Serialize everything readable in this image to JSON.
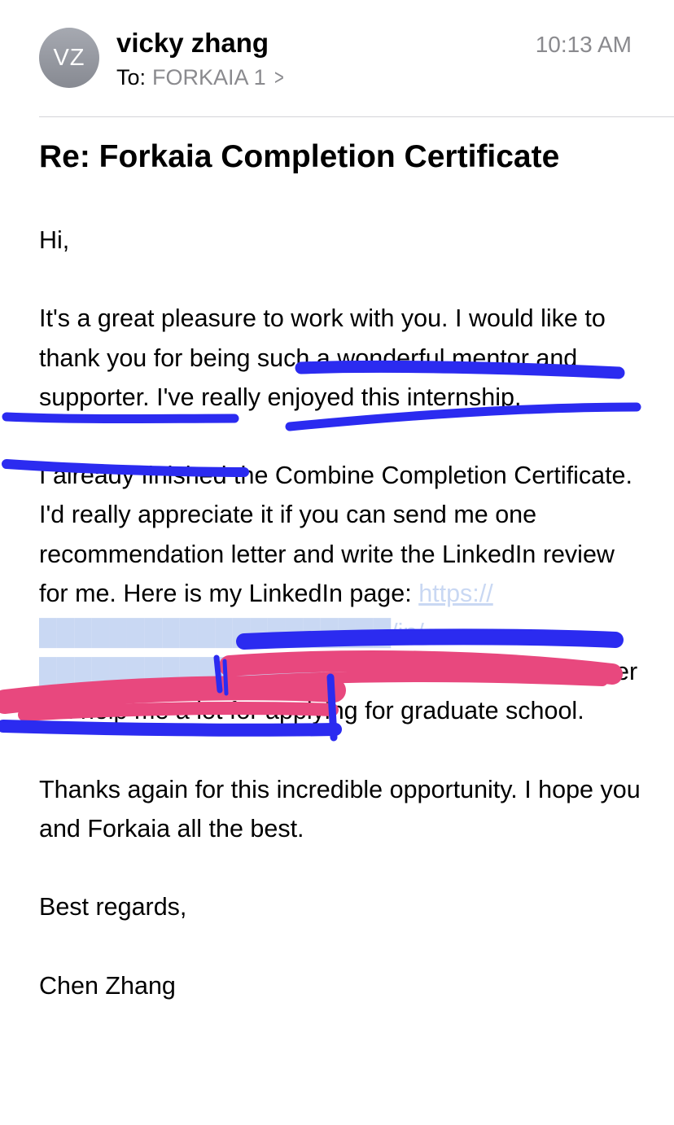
{
  "header": {
    "avatar_initials": "VZ",
    "sender_name": "vicky zhang",
    "time": "10:13 AM",
    "to_label": "To:",
    "recipient": "FORKAIA 1",
    "chevron": "chevron-right-icon"
  },
  "email": {
    "subject": "Re: Forkaia Completion Certificate",
    "greeting": "Hi,",
    "para1": "It's a great pleasure to work with you. I would like to thank you for being such a wonderful mentor and supporter. I've really enjoyed this internship.",
    "para2_before": "I already finished the Combine Completion Certificate. I'd really appreciate it if you can send me one recommendation letter and write the LinkedIn review for me. Here is my LinkedIn page: ",
    "para2_link": "https://████████████████████/in/████████████████/",
    "para2_after": ". The recommendation letter will help me a lot for applying for graduate school.",
    "para3": "Thanks again for this incredible opportunity. I hope you and Forkaia all the best.",
    "closing": "Best regards,",
    "signature": "Chen Zhang"
  },
  "colors": {
    "link": "#2f6fd6",
    "secondary_text": "#8a8a8e",
    "blue_marker": "#2b2bf0",
    "pink_marker": "#e8487e"
  }
}
